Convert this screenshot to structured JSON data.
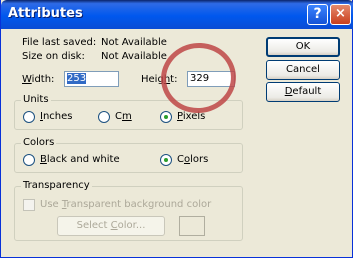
{
  "titlebar": {
    "title": "Attributes",
    "help_icon": "?",
    "close_icon": "×",
    "colors": {
      "start": "#0a246a",
      "mid": "#0058ee",
      "close": "#c93f1e"
    }
  },
  "info": {
    "last_saved_label": "File last saved:",
    "last_saved_value": "Not Available",
    "size_label": "Size on disk:",
    "size_value": "Not Available"
  },
  "dimensions": {
    "width_label_u": "W",
    "width_label_rest": "idth:",
    "width_value": "253",
    "height_label_pre": "Heig",
    "height_label_u": "h",
    "height_label_rest": "t:",
    "height_value": "329"
  },
  "buttons": {
    "ok": "OK",
    "cancel": "Cancel",
    "default_u": "D",
    "default_rest": "efault"
  },
  "units": {
    "title": "Units",
    "inches_u": "I",
    "inches_rest": "nches",
    "cm_pre": "C",
    "cm_u": "m",
    "pixels_u": "P",
    "pixels_rest": "ixels",
    "selected": "Pixels"
  },
  "colors": {
    "title": "Colors",
    "bw_u": "B",
    "bw_rest": "lack and white",
    "colors_u": "o",
    "colors_pre": "C",
    "colors_rest": "lors",
    "selected": "Colors"
  },
  "transparency": {
    "title": "Transparency",
    "use_pre": "Use ",
    "use_u": "T",
    "use_rest": "ransparent background color",
    "select_pre": "Select ",
    "select_u": "C",
    "select_rest": "olor...",
    "checked": false
  },
  "annotation": {
    "color": "#be4646"
  }
}
